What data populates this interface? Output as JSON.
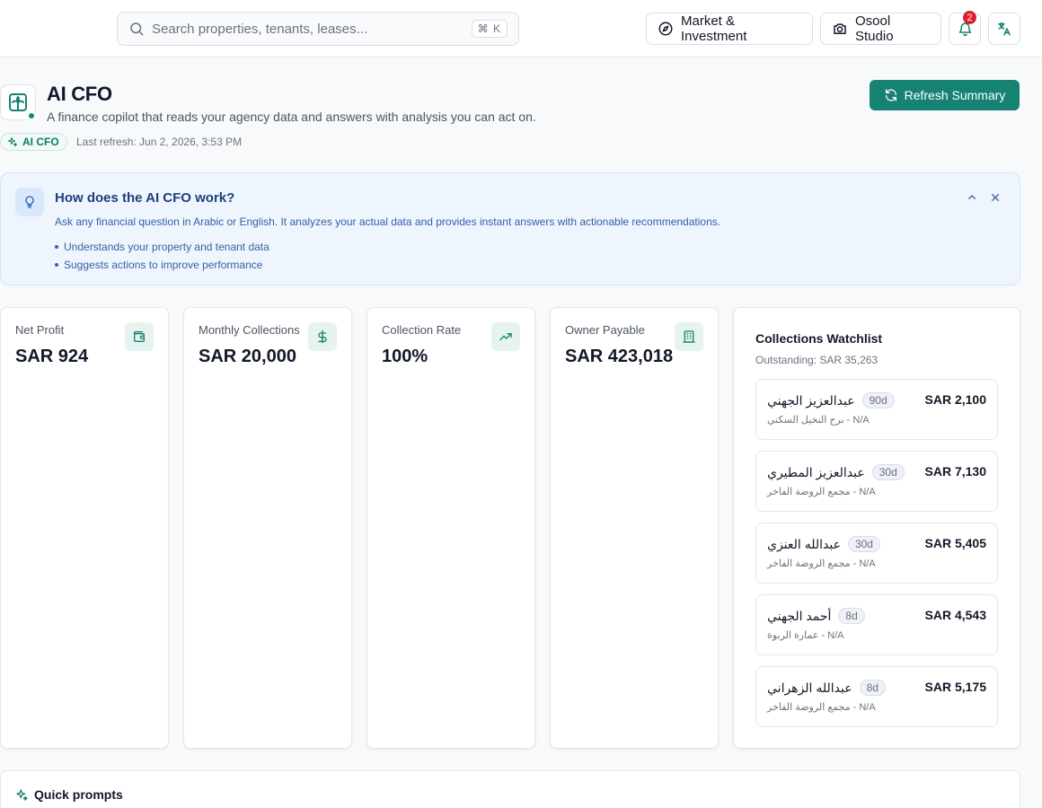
{
  "topbar": {
    "search_placeholder": "Search properties, tenants, leases...",
    "shortcut": "⌘ K",
    "market_label": "Market & Investment",
    "studio_label": "Osool Studio",
    "notification_count": "2"
  },
  "header": {
    "title": "AI CFO",
    "subtitle": "A finance copilot that reads your agency data and answers with analysis you can act on.",
    "chip": "AI CFO",
    "last_refresh": "Last refresh: Jun 2, 2026, 3:53 PM",
    "refresh_button": "Refresh Summary"
  },
  "info": {
    "title": "How does the AI CFO work?",
    "description": "Ask any financial question in Arabic or English. It analyzes your actual data and provides instant answers with actionable recommendations.",
    "points": [
      "Understands your property and tenant data",
      "Suggests actions to improve performance"
    ]
  },
  "kpis": [
    {
      "label": "Net Profit",
      "value": "SAR 924",
      "icon": "wallet-icon"
    },
    {
      "label": "Monthly Collections",
      "value": "SAR 20,000",
      "icon": "dollar-icon"
    },
    {
      "label": "Collection Rate",
      "value": "100%",
      "icon": "trending-up-icon"
    },
    {
      "label": "Owner Payable",
      "value": "SAR 423,018",
      "icon": "building-icon"
    }
  ],
  "watchlist": {
    "title": "Collections Watchlist",
    "outstanding": "Outstanding: SAR 35,263",
    "items": [
      {
        "name": "عبدالعزيز الجهني",
        "days": "90d",
        "amount": "SAR 2,100",
        "property": "برج النخيل السكني - N/A"
      },
      {
        "name": "عبدالعزيز المطيري",
        "days": "30d",
        "amount": "SAR 7,130",
        "property": "مجمع الروضة الفاخر - N/A"
      },
      {
        "name": "عبدالله العنزي",
        "days": "30d",
        "amount": "SAR 5,405",
        "property": "مجمع الروضة الفاخر - N/A"
      },
      {
        "name": "أحمد الجهني",
        "days": "8d",
        "amount": "SAR 4,543",
        "property": "عمارة الربوة - N/A"
      },
      {
        "name": "عبدالله الزهراني",
        "days": "8d",
        "amount": "SAR 5,175",
        "property": "مجمع الروضة الفاخر - N/A"
      }
    ]
  },
  "quick_prompts": {
    "title": "Quick prompts"
  },
  "colors": {
    "accent": "#168272",
    "info_bg": "#eef5fd",
    "badge": "#e11d2e"
  }
}
